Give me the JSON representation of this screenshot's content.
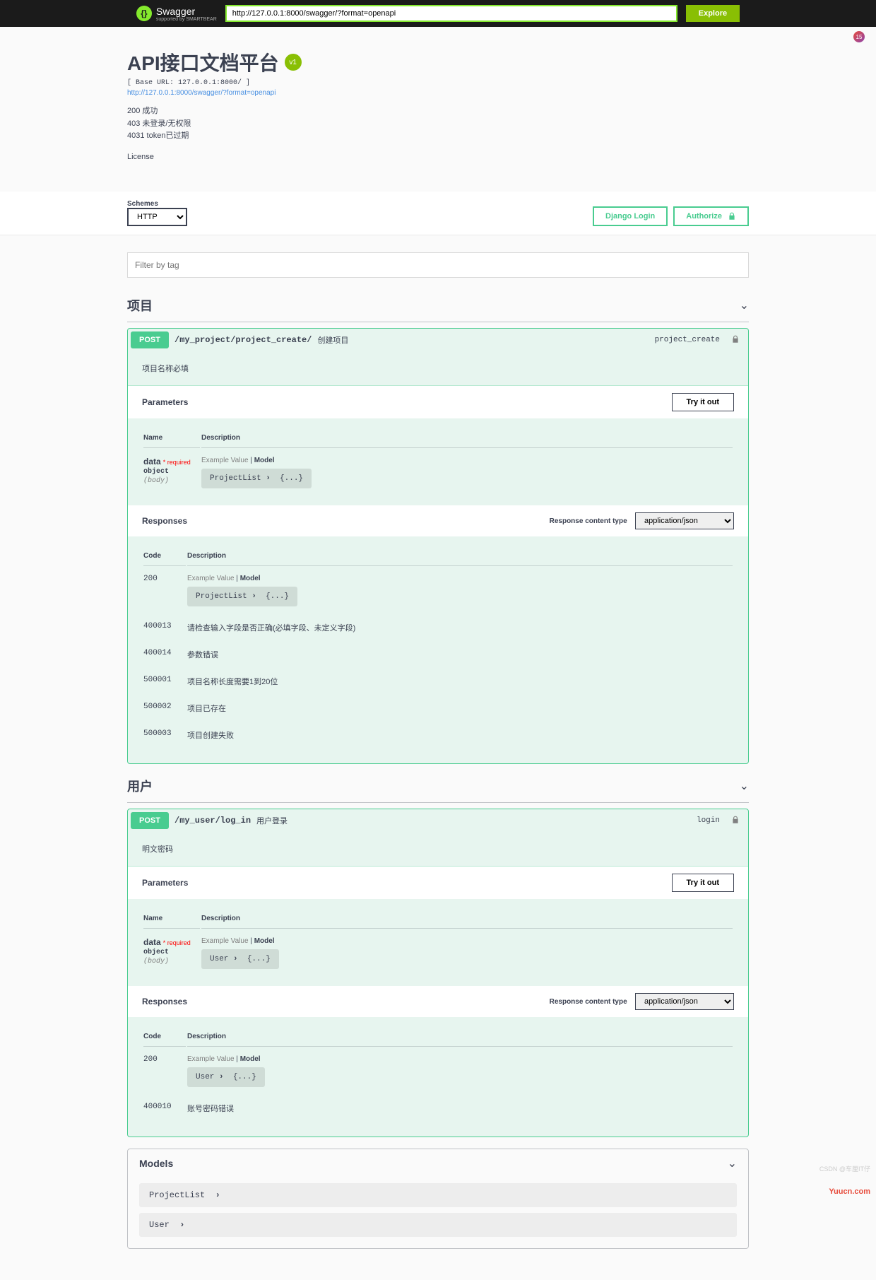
{
  "topbar": {
    "logo": "Swagger",
    "logo_sub": "supported by SMARTBEAR",
    "url_value": "http://127.0.0.1:8000/swagger/?format=openapi",
    "explore": "Explore"
  },
  "badge_count": "15",
  "info": {
    "title": "API接口文档平台",
    "version": "v1",
    "base_url": "[ Base URL: 127.0.0.1:8000/ ]",
    "swagger_url": "http://127.0.0.1:8000/swagger/?format=openapi",
    "description": "200 成功\n403 未登录/无权限\n4031 token已过期",
    "license": "License"
  },
  "schemes": {
    "label": "Schemes",
    "selected": "HTTP"
  },
  "auth": {
    "django_login": "Django Login",
    "authorize": "Authorize"
  },
  "filter": {
    "placeholder": "Filter by tag"
  },
  "labels": {
    "parameters": "Parameters",
    "responses": "Responses",
    "try_it_out": "Try it out",
    "name": "Name",
    "description": "Description",
    "code": "Code",
    "example_value": "Example Value",
    "model": "Model",
    "required": "* required",
    "response_content_type": "Response content type",
    "content_type": "application/json",
    "models": "Models"
  },
  "tags": [
    {
      "name": "项目",
      "ops": [
        {
          "method": "POST",
          "path": "/my_project/project_create/",
          "summary": "创建项目",
          "op_id": "project_create",
          "body_desc": "项目名称必填",
          "param": {
            "name": "data",
            "type": "object",
            "in": "(body)",
            "model": "ProjectList",
            "braces": "{...}"
          },
          "responses": [
            {
              "code": "200",
              "model": "ProjectList",
              "braces": "{...}"
            },
            {
              "code": "400013",
              "desc": "请检查输入字段是否正确(必填字段、未定义字段)"
            },
            {
              "code": "400014",
              "desc": "参数错误"
            },
            {
              "code": "500001",
              "desc": "项目名称长度需要1到20位"
            },
            {
              "code": "500002",
              "desc": "项目已存在"
            },
            {
              "code": "500003",
              "desc": "项目创建失败"
            }
          ]
        }
      ]
    },
    {
      "name": "用户",
      "ops": [
        {
          "method": "POST",
          "path": "/my_user/log_in",
          "summary": "用户登录",
          "op_id": "login",
          "body_desc": "明文密码",
          "param": {
            "name": "data",
            "type": "object",
            "in": "(body)",
            "model": "User",
            "braces": "{...}"
          },
          "responses": [
            {
              "code": "200",
              "model": "User",
              "braces": "{...}"
            },
            {
              "code": "400010",
              "desc": "账号密码错误"
            }
          ]
        }
      ]
    }
  ],
  "models": [
    {
      "name": "ProjectList"
    },
    {
      "name": "User"
    }
  ],
  "watermark": "CSDN @车厘IT仔",
  "yuucn": "Yuucn.com"
}
